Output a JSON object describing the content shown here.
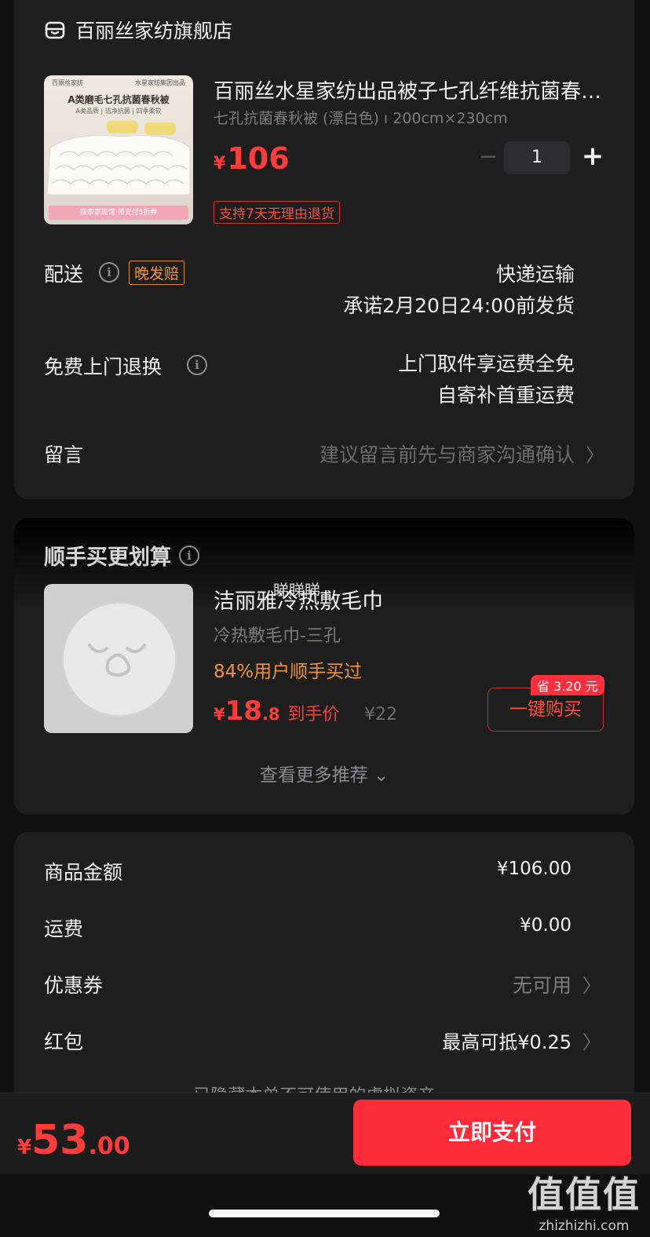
{
  "store": {
    "name": "百丽丝家纺旗舰店",
    "icon": "store-icon"
  },
  "product": {
    "title": "百丽丝水星家纺出品被子七孔纤维抗菌春秋被",
    "spec": "七孔抗菌春秋被 (漂白色) ı 200cm×230cm",
    "currency": "¥",
    "price": "106",
    "quantity": "1",
    "minus": "−",
    "plus": "+",
    "return_tag": "支持7天无理由退货",
    "image_text": {
      "brand_left": "百丽丝家纺",
      "brand_right": "水星家纺集团出品",
      "headline": "A类磨毛七孔抗菌春秋被",
      "sub": "A类品质 | 洁净抗菌 | 四季柔软",
      "promo": "搜索家居馆 领支付5折券"
    }
  },
  "delivery": {
    "label": "配送",
    "tag": "晚发赔",
    "method": "快递运输",
    "promise": "承诺2月20日24:00前发货"
  },
  "free_return": {
    "label": "免费上门退换",
    "line1": "上门取件享运费全免",
    "line2": "自寄补首重运费"
  },
  "message": {
    "label": "留言",
    "hint": "建议留言前先与商家沟通确认",
    "chevron": "〉"
  },
  "reco": {
    "title": "顺手买更划算",
    "item": {
      "title": "洁丽雅冷热敷毛巾",
      "overlay": "睇睇睇",
      "spec": "冷热敷毛巾-三孔",
      "stat": "84%用户顺手买过",
      "currency": "¥",
      "price_int": "18",
      "price_dec": ".8",
      "price_label": "到手价",
      "orig_price": "¥22",
      "save_badge": "省 3.20 元",
      "buy_label": "一键购买"
    },
    "more": "查看更多推荐 ⌄"
  },
  "summary": {
    "rows": [
      {
        "label": "商品金额",
        "value": "¥106.00"
      },
      {
        "label": "运费",
        "value": "¥0.00"
      },
      {
        "label": "优惠券",
        "value": "无可用",
        "chevron": "〉"
      },
      {
        "label": "红包",
        "value": "最高可抵¥0.25",
        "chevron": "〉"
      }
    ],
    "hidden_note": "已隐藏本单不可使用的虚拟资产 ⌄"
  },
  "bottom": {
    "currency": "¥",
    "total_int": "53",
    "total_dec": ".00",
    "pay_label": "立即支付"
  },
  "watermark": {
    "big": "值值值",
    "small": "zhizhizhi.com"
  },
  "colors": {
    "accent": "#ff3c3c",
    "orange": "#f0923b",
    "pay_button": "#fe2c3a",
    "background": "#111111",
    "card": "#1e1e1f"
  }
}
